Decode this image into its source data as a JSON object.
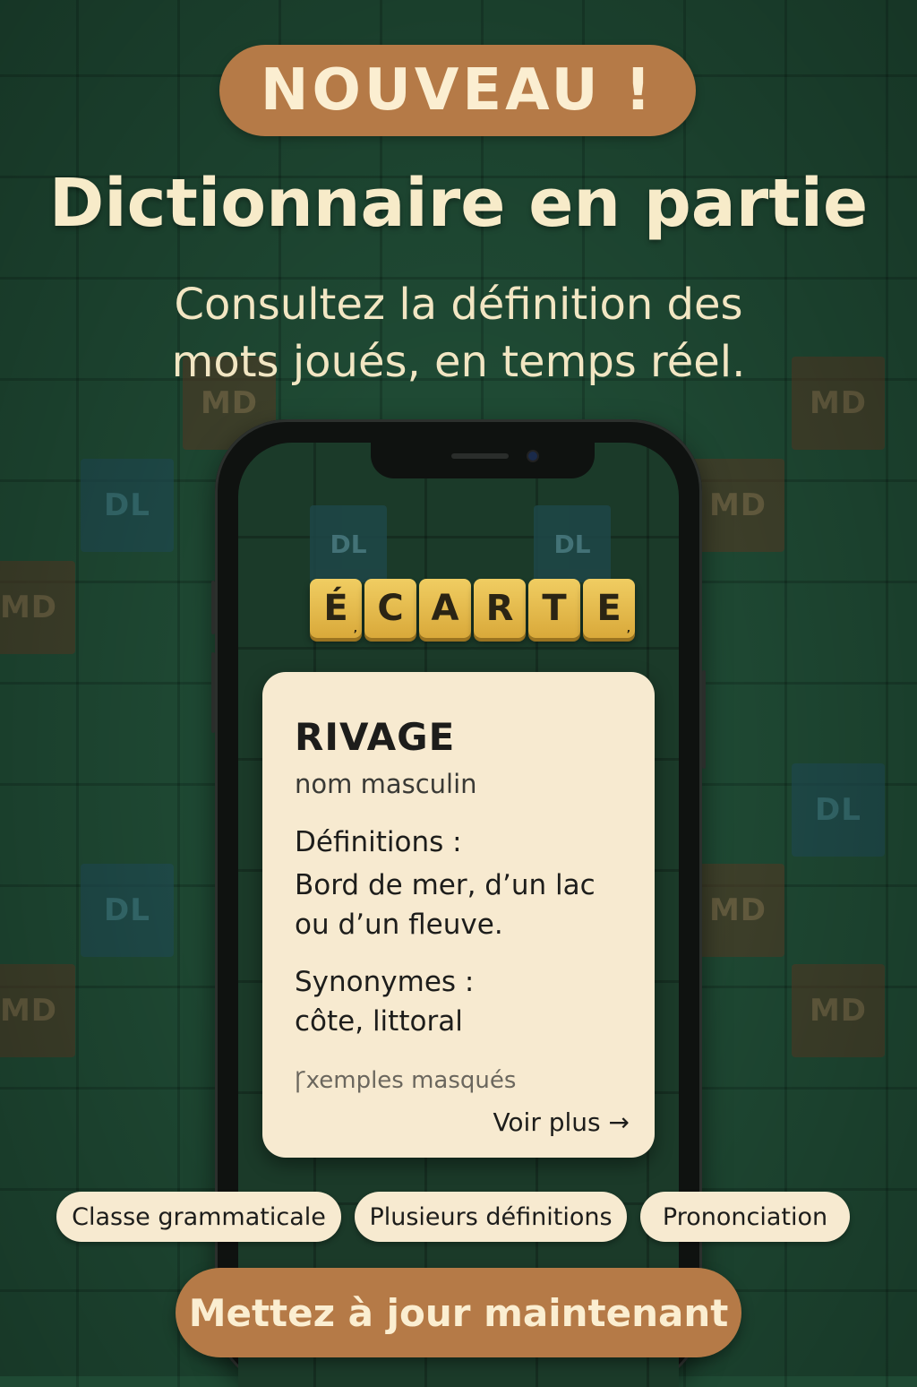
{
  "colors": {
    "accent": "#b57a47",
    "background": "#1f4a34",
    "card": "#f7ead0",
    "tile": "#e6bb4b"
  },
  "badge": "NOUVEAU !",
  "title": "Dictionnaire en partie",
  "subtitle_line1": "Consultez la définition des",
  "subtitle_line2": "mots joués, en temps réel.",
  "board_labels": {
    "md": "MD",
    "dl": "DL"
  },
  "word_tiles": [
    {
      "letter": "É",
      "points": ","
    },
    {
      "letter": "C",
      "points": ""
    },
    {
      "letter": "A",
      "points": ""
    },
    {
      "letter": "R",
      "points": ""
    },
    {
      "letter": "T",
      "points": ""
    },
    {
      "letter": "E",
      "points": ","
    }
  ],
  "definition_card": {
    "word": "RIVAGE",
    "part_of_speech": "nom masculin",
    "definitions_label": "Définitions :",
    "definition_line1": "Bord de mer, d’un lac",
    "definition_line2": "ou d’un fleuve.",
    "synonyms_label": "Synonymes :",
    "synonyms": "côte, littoral",
    "examples": "Ꞅxemples masqués",
    "more_link": "Voir plus →"
  },
  "features": [
    "Classe grammaticale",
    "Plusieurs définitions",
    "Prononciation"
  ],
  "cta": "Mettez à jour maintenant"
}
